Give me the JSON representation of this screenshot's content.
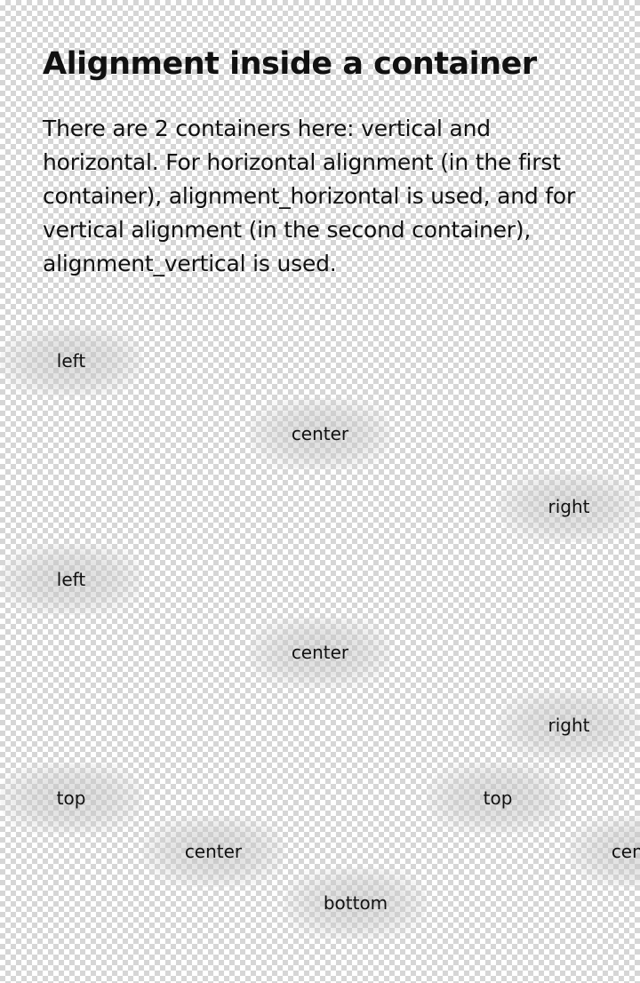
{
  "heading": "Alignment inside a container",
  "description": "There are 2 containers here: vertical and horizontal. For horizontal alignment (in the first container), alignment_horizontal is used, and for vertical alignment (in the second container), alignment_vertical is used.",
  "horizontal_container_1": {
    "items": [
      "left",
      "center",
      "right"
    ]
  },
  "horizontal_container_2": {
    "items": [
      "left",
      "center",
      "right"
    ]
  },
  "vertical_container": {
    "items": [
      "top",
      "center",
      "bottom",
      "top",
      "center"
    ]
  },
  "colors": {
    "text": "#111111",
    "checker_light": "#ffffff",
    "checker_dark": "#d6d6d6"
  }
}
